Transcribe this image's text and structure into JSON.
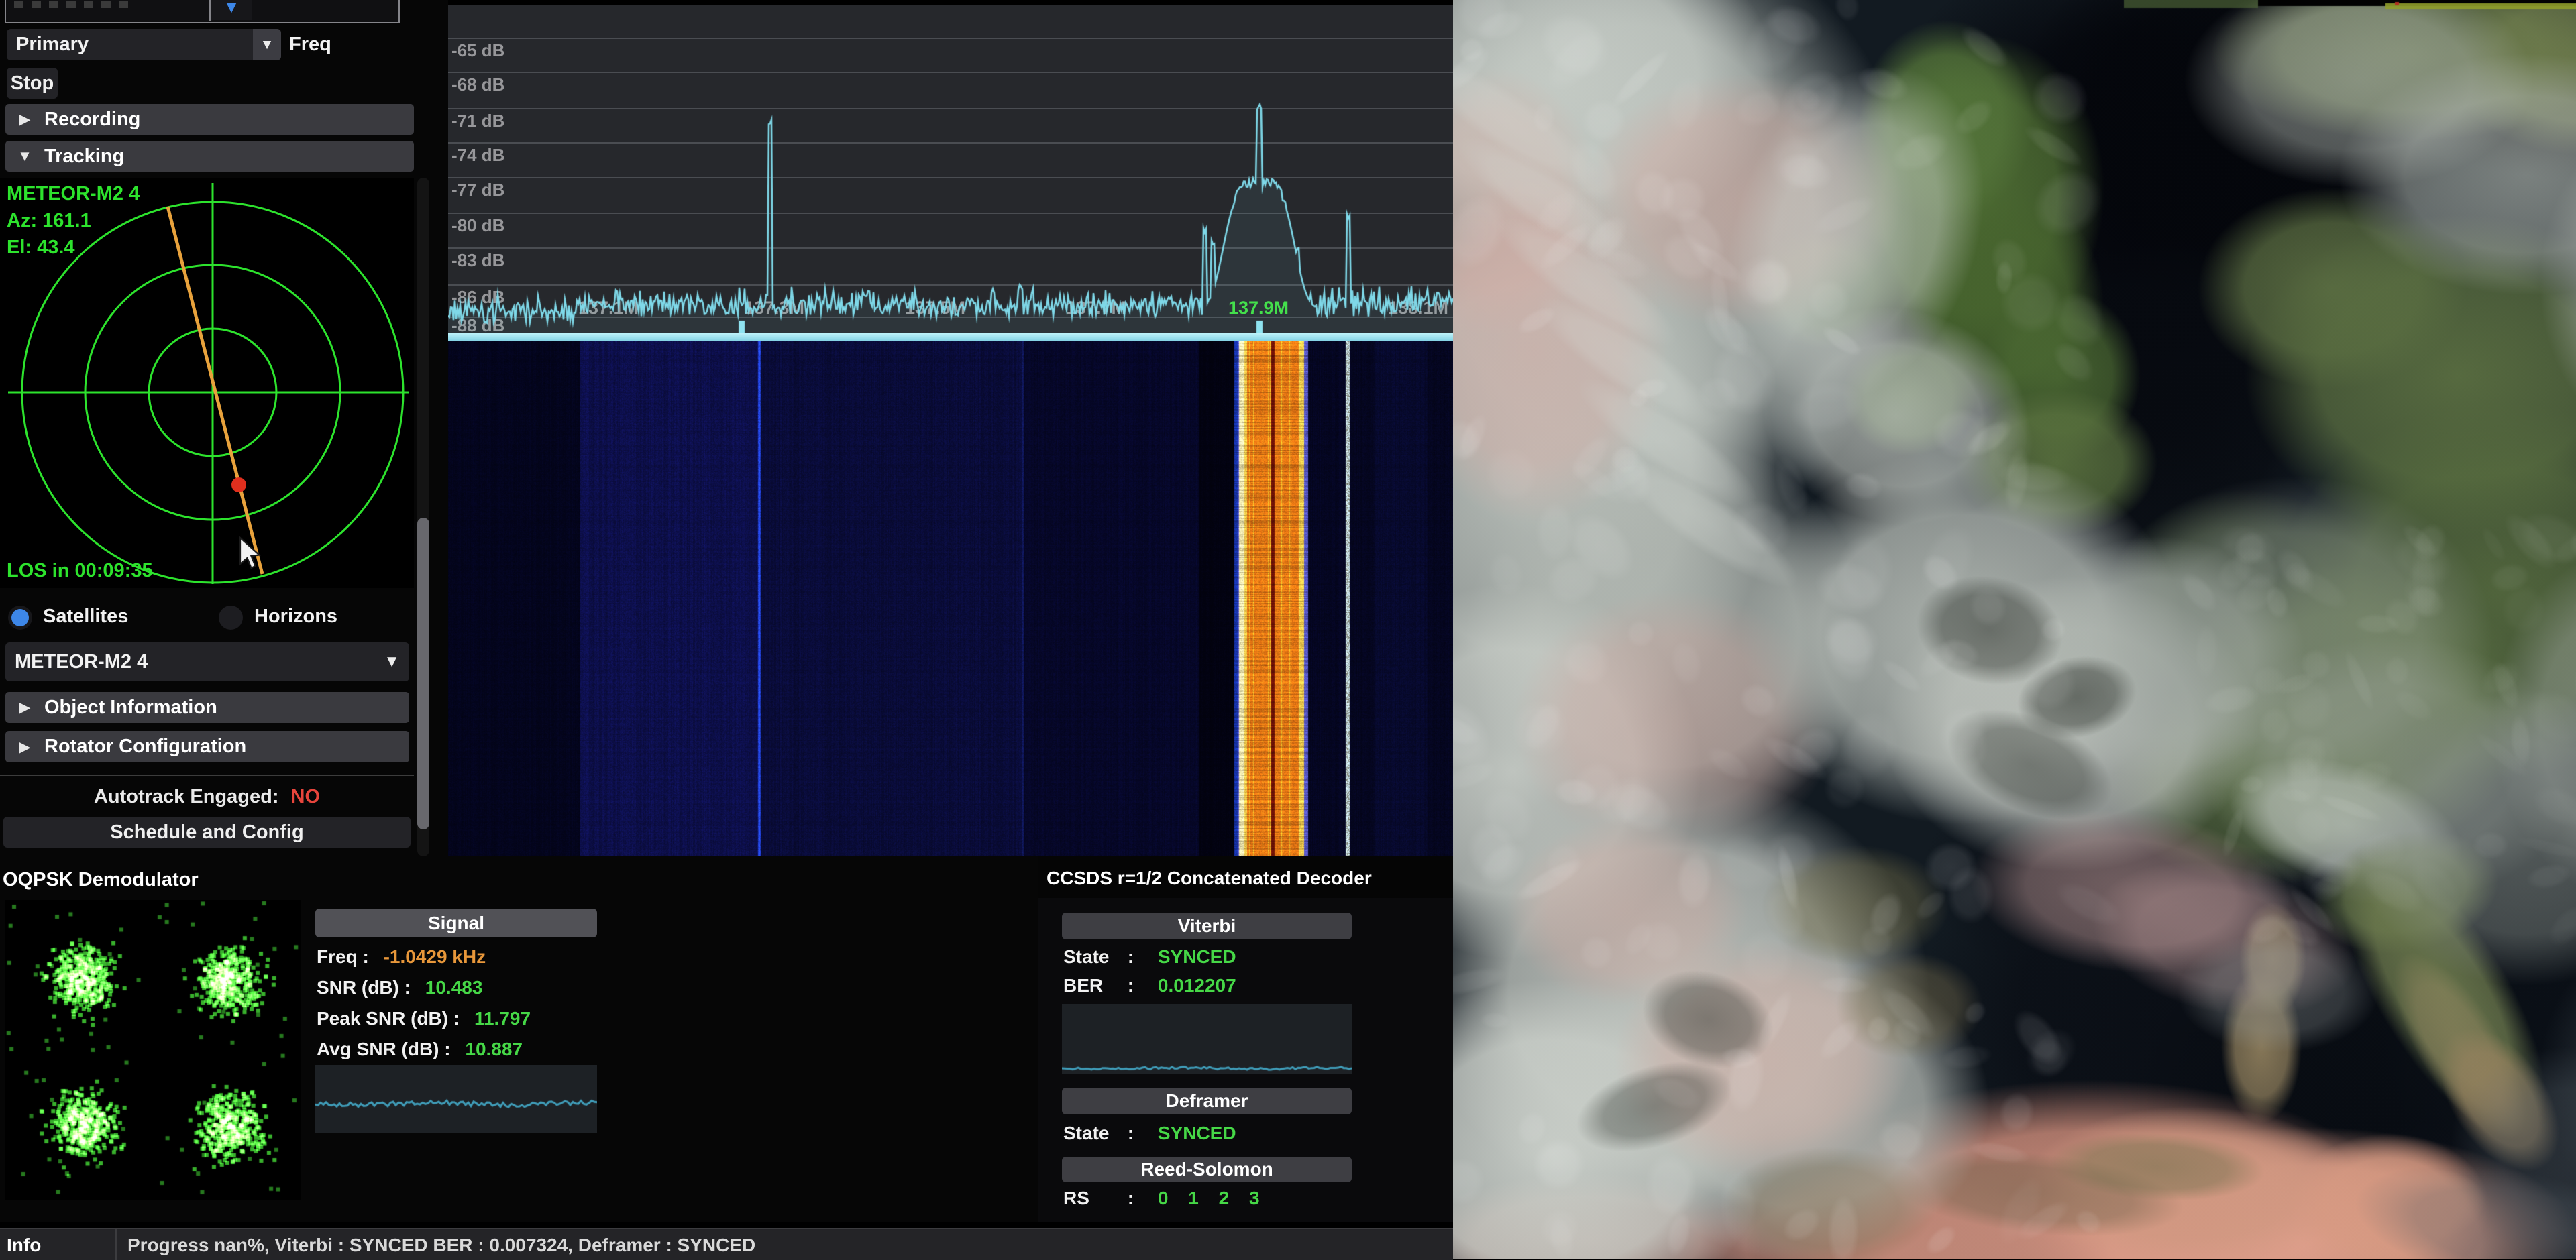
{
  "colors": {
    "accent-blue": "#3d87e8",
    "green": "#3fe03f",
    "radar-green": "#2de32d",
    "value-green": "#46d847",
    "orange": "#e8973a",
    "red": "#e8453c",
    "cyan": "#7fd9e9"
  },
  "left_panel": {
    "device_combo_arrow": "▼",
    "primary_combo": "Primary",
    "freq_label": "Freq",
    "stop_button": "Stop",
    "recording_header": "Recording",
    "tracking_header": "Tracking",
    "radar": {
      "satellite": "METEOR-M2 4",
      "azimuth": "Az: 161.1",
      "elevation": "El: 43.4",
      "los": "LOS in 00:09:35"
    },
    "satellites_radio": "Satellites",
    "horizons_radio": "Horizons",
    "satellite_combo": "METEOR-M2 4",
    "object_information_header": "Object Information",
    "rotator_configuration_header": "Rotator Configuration",
    "autotrack_label": "Autotrack Engaged:",
    "autotrack_value": "NO",
    "schedule_button": "Schedule and Config"
  },
  "fft": {
    "db_labels": [
      "-65 dB",
      "-68 dB",
      "-71 dB",
      "-74 dB",
      "-77 dB",
      "-80 dB",
      "-83 dB",
      "-86 dB",
      "-88 dB"
    ],
    "freq_labels": [
      "137.1M",
      "137.3M",
      "137.5M",
      "137.7M",
      "137.9M",
      "138.1M"
    ],
    "tuned_label": "137.9M"
  },
  "demodulator": {
    "title": "OQPSK Demodulator",
    "signal_header": "Signal",
    "rows": [
      {
        "label": "Freq :",
        "value": "-1.0429 kHz"
      },
      {
        "label": "SNR (dB) :",
        "value": "10.483"
      },
      {
        "label": "Peak SNR (dB) :",
        "value": "11.797"
      },
      {
        "label": "Avg SNR (dB) :",
        "value": "10.887"
      }
    ]
  },
  "decoder": {
    "title": "CCSDS r=1/2 Concatenated Decoder",
    "viterbi_header": "Viterbi",
    "state_label": "State",
    "ber_label": "BER",
    "colon": ":",
    "viterbi_state": "SYNCED",
    "viterbi_ber": "0.012207",
    "deframer_header": "Deframer",
    "deframer_state": "SYNCED",
    "reed_solomon_header": "Reed-Solomon",
    "rs_label": "RS",
    "rs_values": [
      "0",
      "1",
      "2",
      "3"
    ]
  },
  "status_bar": {
    "section": "Info",
    "message": "Progress nan%, Viterbi : SYNCED BER : 0.007324, Deframer : SYNCED"
  }
}
